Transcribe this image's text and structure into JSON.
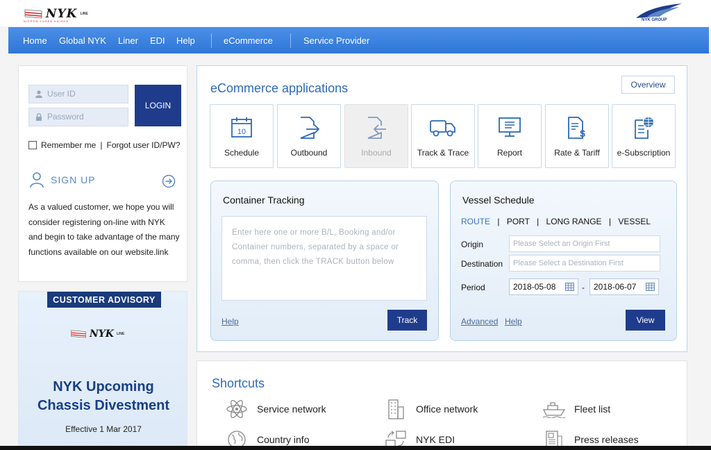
{
  "brand": {
    "logo_text": "NYK",
    "logo_line": "LINE",
    "logo_sub": "NIPPON YUSEN KAISHA",
    "group_logo": "NYK GROUP"
  },
  "nav": {
    "items": [
      {
        "label": "Home"
      },
      {
        "label": "Global NYK"
      },
      {
        "label": "Liner"
      },
      {
        "label": "EDI"
      },
      {
        "label": "Help"
      },
      {
        "label": "eCommerce"
      },
      {
        "label": "Service Provider"
      }
    ]
  },
  "login": {
    "user_id_placeholder": "User ID",
    "password_placeholder": "Password",
    "login_label": "LOGIN",
    "remember_label": "Remember me",
    "separator": "|",
    "forgot_label": "Forgot user ID/PW?",
    "signup_label": "SIGN UP",
    "signup_text": "As a valued customer, we hope you will consider registering on-line with NYK and begin to take advantage of the many functions available on our website.link"
  },
  "advisory": {
    "tag": "CUSTOMER ADVISORY",
    "title_line1": "NYK Upcoming",
    "title_line2": "Chassis Divestment",
    "effective": "Effective 1 Mar 2017"
  },
  "ecommerce": {
    "title": "eCommerce applications",
    "overview_label": "Overview",
    "apps": [
      {
        "label": "Schedule",
        "icon": "calendar-icon",
        "day": "10"
      },
      {
        "label": "Outbound",
        "icon": "outbound-icon"
      },
      {
        "label": "Inbound",
        "icon": "inbound-icon"
      },
      {
        "label": "Track & Trace",
        "icon": "truck-icon"
      },
      {
        "label": "Report",
        "icon": "monitor-report-icon"
      },
      {
        "label": "Rate & Tariff",
        "icon": "rate-document-icon"
      },
      {
        "label": "e-Subscription",
        "icon": "subscription-globe-icon"
      }
    ]
  },
  "container_tracking": {
    "title": "Container Tracking",
    "placeholder": "Enter here one or more B/L, Booking and/or Container numbers, separated by a space or comma, then click the TRACK button below",
    "help_label": "Help",
    "track_label": "Track"
  },
  "vessel_schedule": {
    "title": "Vessel Schedule",
    "tabs": [
      "ROUTE",
      "PORT",
      "LONG RANGE",
      "VESSEL"
    ],
    "tab_separator": "|",
    "origin_label": "Origin",
    "origin_placeholder": "Please Select an Origin First",
    "destination_label": "Destination",
    "destination_placeholder": "Please Select a Destination First",
    "period_label": "Period",
    "period_from": "2018-05-08",
    "period_dash": "-",
    "period_to": "2018-06-07",
    "advanced_label": "Advanced",
    "help_label": "Help",
    "view_label": "View"
  },
  "shortcuts": {
    "title": "Shortcuts",
    "items": [
      {
        "label": "Service network",
        "icon": "atom-network-icon"
      },
      {
        "label": "Office network",
        "icon": "building-icon"
      },
      {
        "label": "Fleet list",
        "icon": "ship-icon"
      },
      {
        "label": "Country info",
        "icon": "globe-icon"
      },
      {
        "label": "NYK EDI",
        "icon": "edi-transfer-icon"
      },
      {
        "label": "Press releases",
        "icon": "press-document-icon"
      }
    ]
  },
  "colors": {
    "nav_blue": "#3a80de",
    "button_navy": "#1f3c8c",
    "title_blue": "#2f6bb8",
    "advisory_navy": "#1a3a7c"
  }
}
